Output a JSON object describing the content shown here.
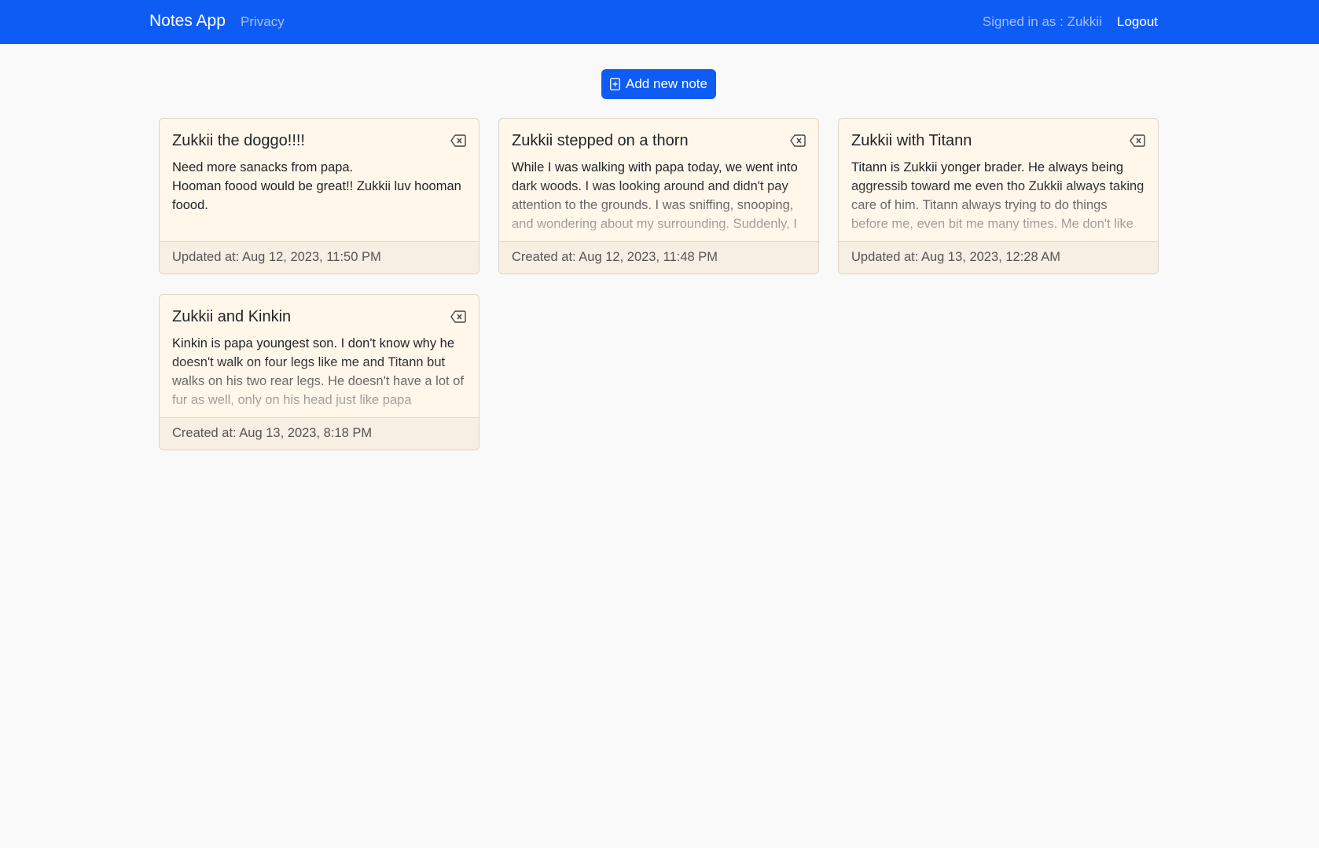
{
  "navbar": {
    "brand": "Notes App",
    "privacy_link": "Privacy",
    "signed_in_text": "Signed in as : Zukkii",
    "logout_link": "Logout"
  },
  "toolbar": {
    "add_note_label": "Add new note",
    "add_note_icon": "file-plus-icon"
  },
  "notes": [
    {
      "title": "Zukkii the doggo!!!!",
      "body_lines": [
        "Need more sanacks from papa.",
        "Hooman foood would be great!! Zukkii luv hooman foood."
      ],
      "footer": "Updated at: Aug 12, 2023, 11:50 PM"
    },
    {
      "title": "Zukkii stepped on a thorn",
      "body": "While I was walking with papa today, we went into dark woods. I was looking around and didn't pay attention to the grounds. I was sniffing, snooping, and wondering about my surrounding. Suddenly, I felt like I got stabbed, oh no, some got stabbed. I",
      "footer": "Created at: Aug 12, 2023, 11:48 PM"
    },
    {
      "title": "Zukkii with Titann",
      "body": "Titann is Zukkii yonger brader. He always being aggressib toward me even tho Zukkii always taking care of him. Titann always trying to do things before me, even bit me many times. Me don't like the way he is, but he's my brader so me love him",
      "footer": "Updated at: Aug 13, 2023, 12:28 AM"
    },
    {
      "title": "Zukkii and Kinkin",
      "body": "Kinkin is papa youngest son. I don't know why he doesn't walk on four legs like me and Titann but walks on his two rear legs. He doesn't have a lot of fur as well, only on his head just like papa",
      "footer": "Created at: Aug 13, 2023, 8:18 PM"
    }
  ],
  "delete_icon": "backspace-icon",
  "colors": {
    "navbar": "#0f5cf5",
    "button": "#0f5cf5",
    "card_bg": "#fff7ea",
    "card_footer_bg": "#f8efe3",
    "page_bg": "#f9f9f9"
  }
}
